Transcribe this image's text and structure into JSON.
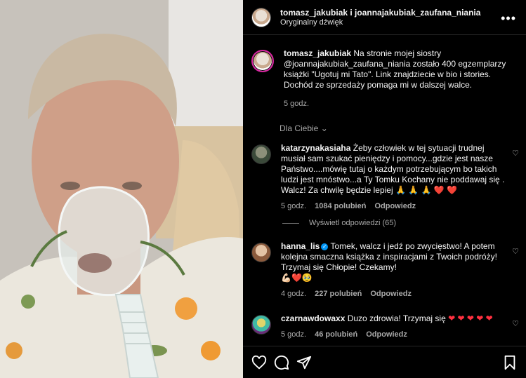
{
  "header": {
    "names": "tomasz_jakubiak i joannajakubiak_zaufana_niania",
    "audio": "Oryginalny dźwięk",
    "more": "•••"
  },
  "caption": {
    "user": "tomasz_jakubiak",
    "text": "Na stronie mojej siostry @joannajakubiak_zaufana_niania zostało 400 egzemplarzy książki \"Ugotuj mi Tato\". Link znajdziecie w bio i stories. Dochód ze sprzedaży pomaga mi w dalszej walce.",
    "time": "5 godz."
  },
  "filter_label": "Dla Ciebie",
  "comments": [
    {
      "user": "katarzynakasiaha",
      "text": "Żeby człowiek w tej sytuacji trudnej musiał sam szukać pieniędzy i pomocy...gdzie jest nasze Państwo....mówię tutaj o każdym potrzebującym bo takich ludzi jest mnóstwo...a Ty Tomku Kochany nie poddawaj się . Walcz! Za chwilę będzie lepiej 🙏 🙏 🙏 ❤️ ❤️",
      "time": "5 godz.",
      "likes": "1084 polubień",
      "reply": "Odpowiedz",
      "view_replies": "Wyświetl odpowiedzi (65)"
    },
    {
      "user": "hanna_lis",
      "verified": "✓",
      "text": "Tomek, walcz i jedź po zwycięstwo! A potem kolejna smaczna książka z inspiracjami z Twoich podróży! Trzymaj się Chłopie! Czekamy!",
      "emoji": "💪🏻❤️🥹",
      "time": "4 godz.",
      "likes": "227 polubień",
      "reply": "Odpowiedz"
    },
    {
      "user": "czarnawdowaxx",
      "text": "Duzo zdrowia! Trzymaj się",
      "hearts": "❤ ❤ ❤ ❤ ❤",
      "time": "5 godz.",
      "likes": "46 polubień",
      "reply": "Odpowiedz"
    }
  ],
  "colors": {
    "accent_heart": "#ff3040",
    "verified": "#0095f6",
    "background": "#000000"
  },
  "icons": [
    "heart-icon",
    "comment-icon",
    "share-icon",
    "bookmark-icon",
    "more-icon",
    "chevron-down-icon"
  ]
}
